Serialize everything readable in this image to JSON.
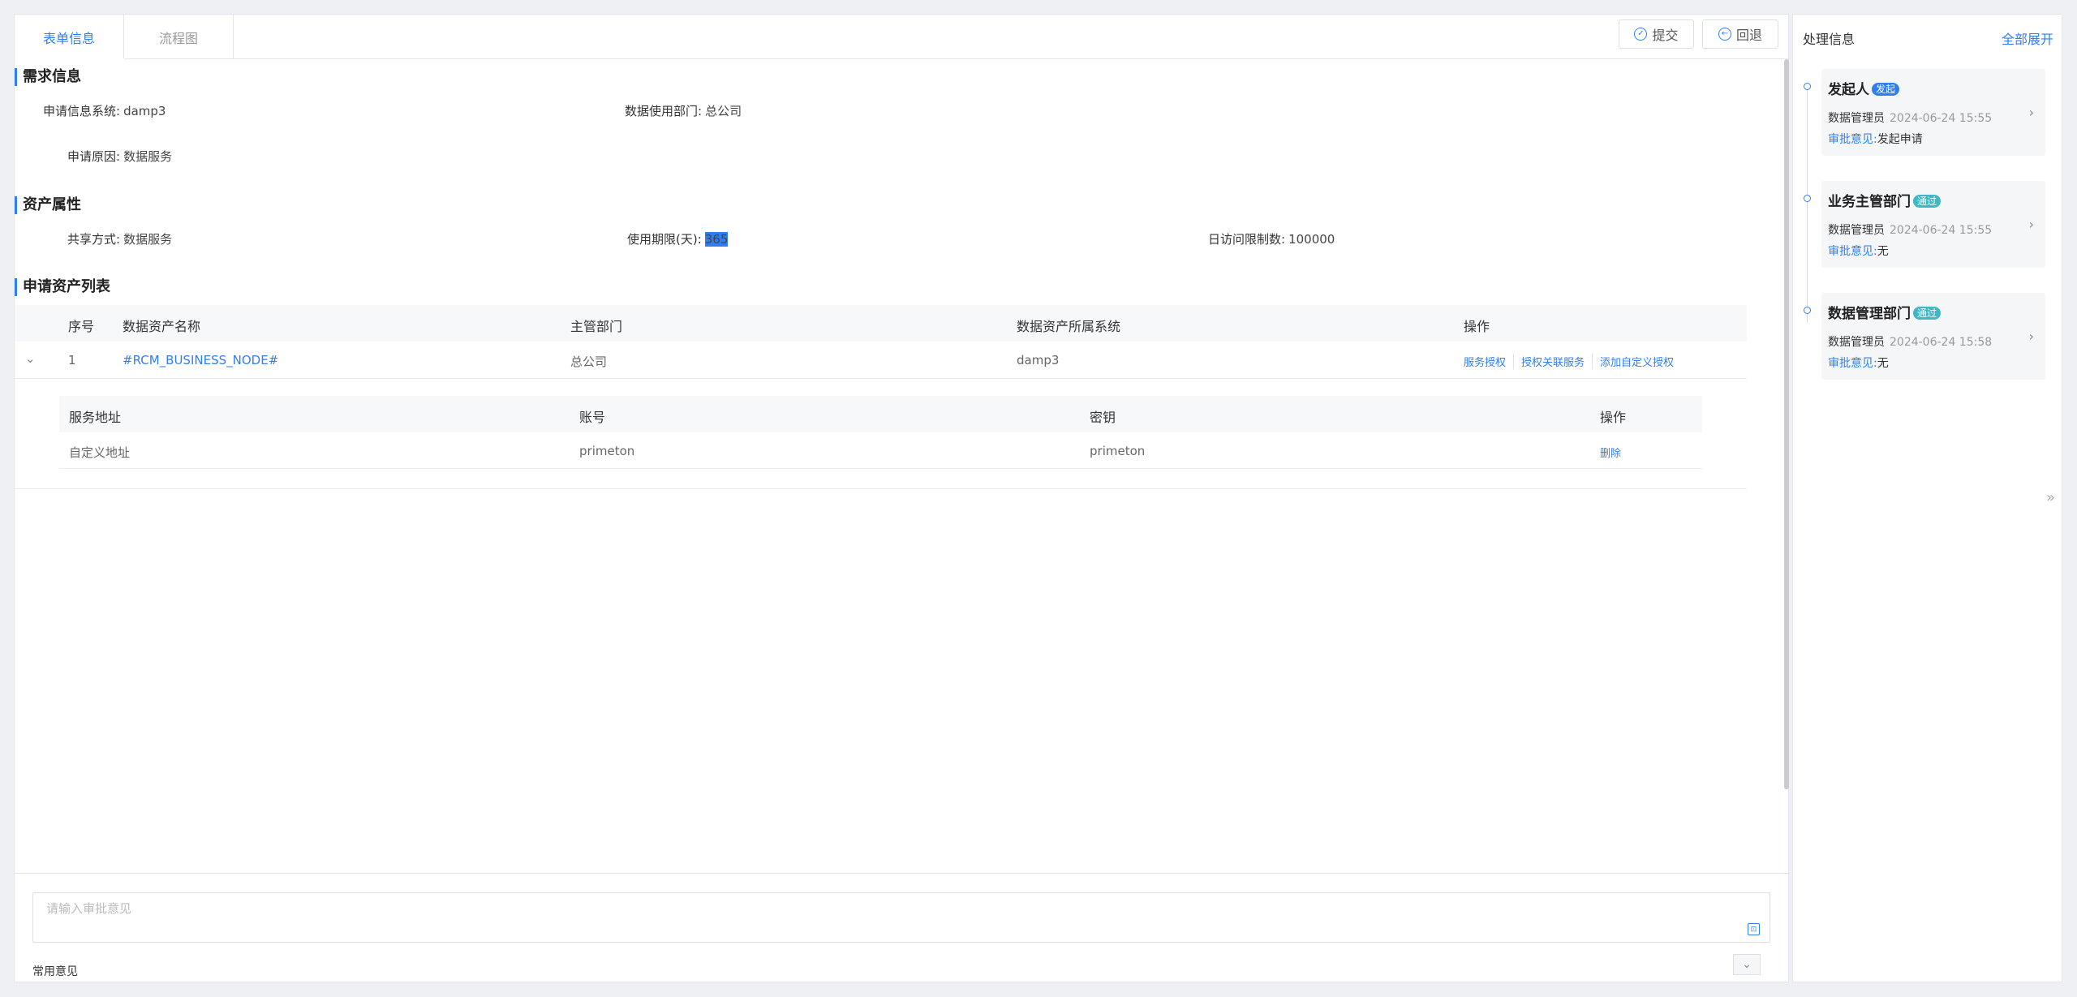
{
  "tabs": [
    {
      "label": "表单信息",
      "active": true
    },
    {
      "label": "流程图",
      "active": false
    }
  ],
  "toolbar": {
    "submit_label": "提交",
    "return_label": "回退"
  },
  "demand": {
    "title": "需求信息",
    "system_label": "申请信息系统:",
    "system_value": "damp3",
    "dept_label": "数据使用部门:",
    "dept_value": "总公司",
    "reason_label": "申请原因:",
    "reason_value": "数据服务"
  },
  "asset": {
    "title": "资产属性",
    "share_label": "共享方式:",
    "share_value": "数据服务",
    "period_label": "使用期限(天):",
    "period_value": "365",
    "daily_label": "日访问限制数:",
    "daily_value": "100000"
  },
  "asset_list": {
    "title": "申请资产列表",
    "columns": [
      "序号",
      "数据资产名称",
      "主管部门",
      "数据资产所属系统",
      "操作"
    ],
    "rows": [
      {
        "index": "1",
        "name": "#RCM_BUSINESS_NODE#",
        "dept": "总公司",
        "system": "damp3",
        "ops": [
          "服务授权",
          "授权关联服务",
          "添加自定义授权"
        ]
      }
    ],
    "sub_columns": [
      "服务地址",
      "账号",
      "密钥",
      "操作"
    ],
    "sub_rows": [
      {
        "address": "自定义地址",
        "account": "primeton",
        "secret": "primeton",
        "op": "删除"
      }
    ]
  },
  "opinion": {
    "placeholder": "请输入审批意见",
    "common_label": "常用意见"
  },
  "side": {
    "title": "处理信息",
    "expand_label": "全部展开",
    "items": [
      {
        "title": "发起人",
        "badge": "发起",
        "badge_color": "#2f7ff0",
        "user": "数据管理员",
        "time": "2024-06-24 15:55",
        "op_key": "审批意见:",
        "op_value": "发起申请"
      },
      {
        "title": "业务主管部门",
        "badge": "通过",
        "badge_color": "#3fb7c4",
        "user": "数据管理员",
        "time": "2024-06-24 15:55",
        "op_key": "审批意见:",
        "op_value": "无"
      },
      {
        "title": "数据管理部门",
        "badge": "通过",
        "badge_color": "#3fb7c4",
        "user": "数据管理员",
        "time": "2024-06-24 15:58",
        "op_key": "审批意见:",
        "op_value": "无"
      }
    ]
  },
  "icons": {
    "submit": "check-circle-icon",
    "return": "back-circle-icon",
    "expand_row": "chevron-down-icon",
    "card_arrow": "chevron-right-icon",
    "collapse_side": "double-chevron-right-icon",
    "opinion_tool": "bookmark-icon",
    "dropdown": "chevron-down-icon"
  }
}
